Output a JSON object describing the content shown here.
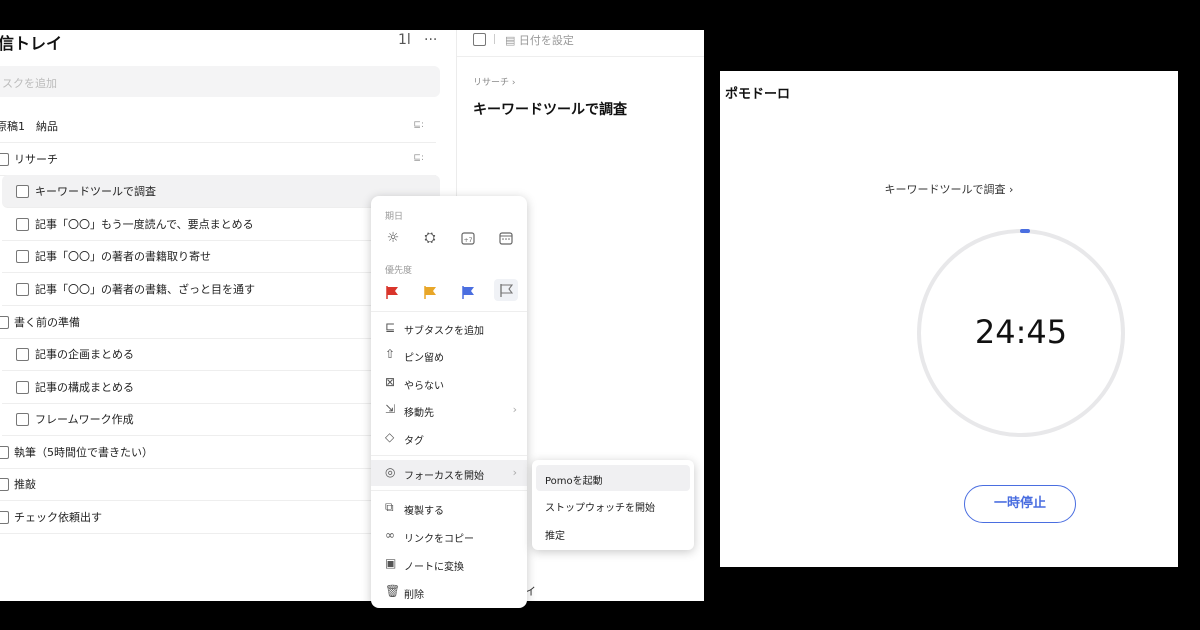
{
  "inbox": {
    "title": "信トレイ",
    "sort_icon": "1l",
    "more_icon": "···",
    "add_placeholder": "スクを追加",
    "tasks": [
      {
        "label": "原稿1　納品",
        "indent": 0,
        "checkbox": false,
        "subtasks_icon": true
      },
      {
        "label": "リサーチ",
        "indent": 0,
        "checkbox": true,
        "subtasks_icon": true
      },
      {
        "label": "キーワードツールで調査",
        "indent": 1,
        "checkbox": true,
        "selected": true
      },
      {
        "label": "記事「〇〇」もう一度読んで、要点まとめる",
        "indent": 1,
        "checkbox": true
      },
      {
        "label": "記事「〇〇」の著者の書籍取り寄せ",
        "indent": 1,
        "checkbox": true
      },
      {
        "label": "記事「〇〇」の著者の書籍、ざっと目を通す",
        "indent": 1,
        "checkbox": true
      },
      {
        "label": "書く前の準備",
        "indent": 0,
        "checkbox": true
      },
      {
        "label": "記事の企画まとめる",
        "indent": 1,
        "checkbox": true
      },
      {
        "label": "記事の構成まとめる",
        "indent": 1,
        "checkbox": true
      },
      {
        "label": "フレームワーク作成",
        "indent": 1,
        "checkbox": true
      },
      {
        "label": "執筆（5時間位で書きたい）",
        "indent": 0,
        "checkbox": true
      },
      {
        "label": "推敲",
        "indent": 0,
        "checkbox": true
      },
      {
        "label": "チェック依頼出す",
        "indent": 0,
        "checkbox": true
      }
    ]
  },
  "detail": {
    "date_label": "日付を設定",
    "breadcrumb": "リサーチ ›",
    "title": "キーワードツールで調査",
    "bottom_fragment": "イ"
  },
  "context_menu": {
    "date_section": "期日",
    "priority_section": "優先度",
    "priority_colors": [
      "#d9352b",
      "#e8a628",
      "#4a6ee0",
      "#888888"
    ],
    "items": [
      {
        "label": "サブタスクを追加",
        "icon": "subtask-icon"
      },
      {
        "label": "ピン留め",
        "icon": "pin-icon"
      },
      {
        "label": "やらない",
        "icon": "wont-do-icon"
      },
      {
        "label": "移動先",
        "icon": "move-icon",
        "chevron": true
      },
      {
        "label": "タグ",
        "icon": "tag-icon"
      },
      {
        "label": "フォーカスを開始",
        "icon": "focus-icon",
        "chevron": true,
        "active": true
      },
      {
        "label": "複製する",
        "icon": "duplicate-icon"
      },
      {
        "label": "リンクをコピー",
        "icon": "link-icon"
      },
      {
        "label": "ノートに変換",
        "icon": "note-icon"
      },
      {
        "label": "削除",
        "icon": "trash-icon"
      }
    ],
    "submenu": [
      "Pomoを起動",
      "ストップウォッチを開始",
      "推定"
    ]
  },
  "pomodoro": {
    "title": "ポモドーロ",
    "task": "キーワードツールで調査 ›",
    "time": "24:45",
    "pause_label": "一時停止",
    "accent": "#4a6ee0"
  }
}
